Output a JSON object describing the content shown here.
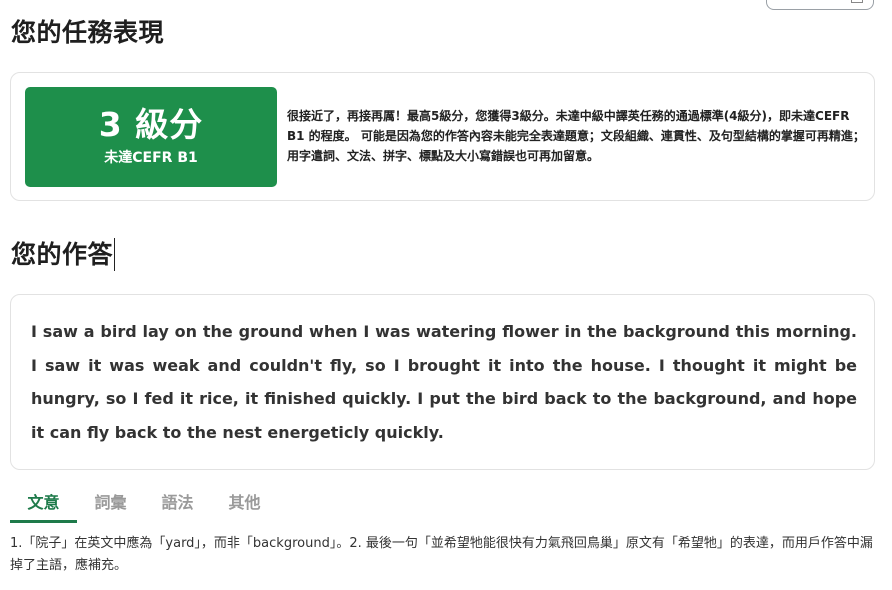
{
  "page": {
    "task_title": "您的任務表現",
    "answer_title": "您的作答"
  },
  "score": {
    "level": "3 級分",
    "sub": "未達CEFR B1",
    "description": "很接近了，再接再厲！最高5級分，您獲得3級分。未達中級中譯英任務的通過標準(4級分)，即未達CEFR B1 的程度。 可能是因為您的作答內容未能完全表達題意；文段組織、連貫性、及句型結構的掌握可再精進；用字遣詞、文法、拼字、標點及大小寫錯誤也可再加留意。",
    "badge_color": "#1e8f4b"
  },
  "answer": {
    "text": "I saw a bird lay on the ground when I was watering flower in the background this morning. I saw it was weak and couldn't fly, so I brought it into the house. I thought it might be hungry, so I fed it rice, it finished quickly. I put the bird back to the background, and hope it can fly back to the nest energeticly quickly."
  },
  "tabs": [
    {
      "label": "文意",
      "active": true
    },
    {
      "label": "詞彙",
      "active": false
    },
    {
      "label": "語法",
      "active": false
    },
    {
      "label": "其他",
      "active": false
    }
  ],
  "feedback": {
    "text": "1.「院子」在英文中應為「yard」，而非「background」。2. 最後一句「並希望牠能很快有力氣飛回鳥巢」原文有「希望牠」的表達，而用戶作答中漏掉了主語，應補充。"
  },
  "colors": {
    "accent": "#1e7a4a",
    "inactive_tab": "#9a9a9a"
  }
}
